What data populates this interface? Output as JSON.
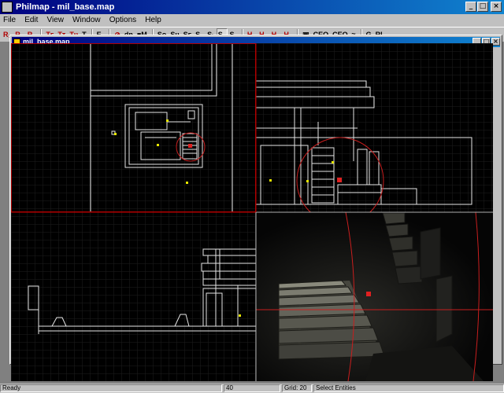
{
  "app": {
    "title": "Philmap - mil_base.map",
    "child_title": "mil_base.map"
  },
  "menu": [
    "File",
    "Edit",
    "View",
    "Window",
    "Options",
    "Help"
  ],
  "toolbar": [
    {
      "label": "R₁",
      "style": "red"
    },
    {
      "label": "R₂",
      "style": "red"
    },
    {
      "label": "R₃",
      "style": "red"
    },
    {
      "label": "sep"
    },
    {
      "label": "Tᴇ",
      "style": "red"
    },
    {
      "label": "Tᴛ",
      "style": "red"
    },
    {
      "label": "Tᴜ",
      "style": "red"
    },
    {
      "label": "T",
      "style": "plain"
    },
    {
      "label": "sep"
    },
    {
      "label": "E₁",
      "style": "plain"
    },
    {
      "label": "sep"
    },
    {
      "label": "⊘",
      "style": "red"
    },
    {
      "label": "dn",
      "style": "plain"
    },
    {
      "label": "■M",
      "style": "plain"
    },
    {
      "label": "sep"
    },
    {
      "label": "Sᴏ",
      "style": "plain"
    },
    {
      "label": "Sᴜ",
      "style": "plain"
    },
    {
      "label": "Sᴇ",
      "style": "plain"
    },
    {
      "label": "S₂",
      "style": "plain"
    },
    {
      "label": "Sₜ",
      "style": "plain"
    },
    {
      "label": "S₁",
      "style": "pressed"
    },
    {
      "label": "Sₐ",
      "style": "plain"
    },
    {
      "label": "sep"
    },
    {
      "label": "H₁",
      "style": "red"
    },
    {
      "label": "H₂",
      "style": "red"
    },
    {
      "label": "H₃",
      "style": "red"
    },
    {
      "label": "H₄",
      "style": "red"
    },
    {
      "label": "sep"
    },
    {
      "label": "▣",
      "style": "plain"
    },
    {
      "label": "CEO",
      "style": "plain"
    },
    {
      "label": "CEO",
      "style": "plain"
    },
    {
      "label": "≈",
      "style": "plain"
    },
    {
      "label": "sep"
    },
    {
      "label": "G",
      "style": "plain"
    },
    {
      "label": "RL",
      "style": "plain"
    }
  ],
  "status": {
    "message": "Ready",
    "value": "40",
    "grid": "Grid: 20",
    "mode": "Select Entities"
  },
  "colors": {
    "grid_line": "#1e1e1e",
    "brush_line": "#e6e6e6",
    "selection": "#c81e1e",
    "entity": "#e6e600",
    "viewport_border": "#b00000"
  }
}
